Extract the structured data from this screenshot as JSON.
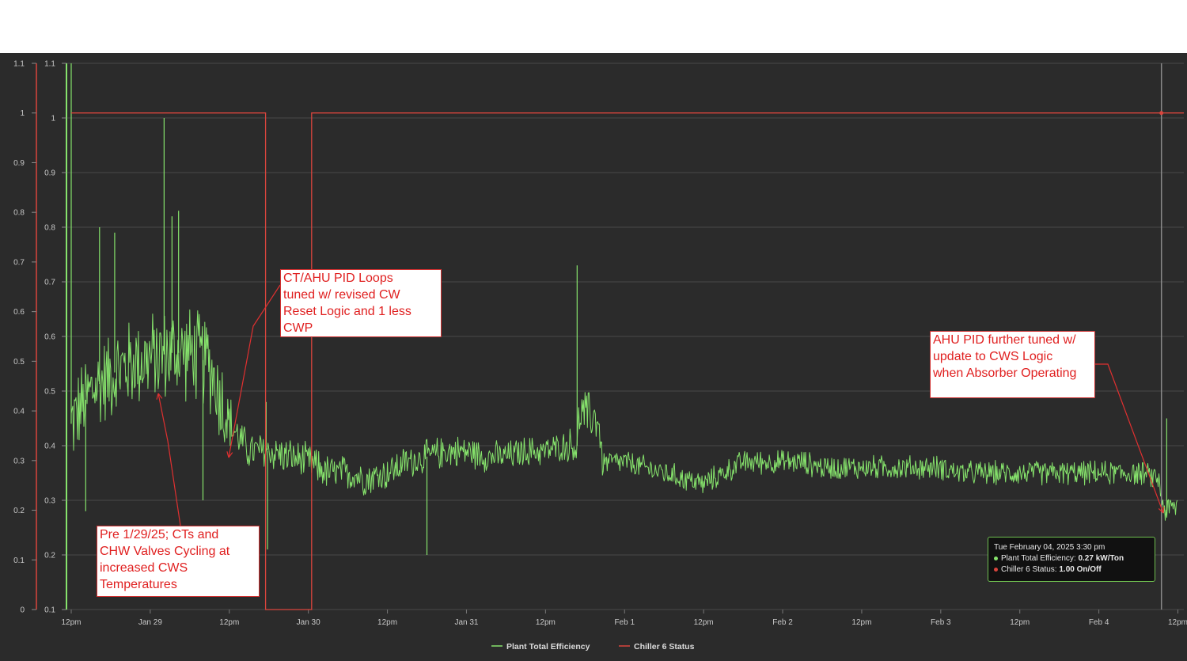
{
  "colors": {
    "background": "#2b2b2b",
    "efficiency": "#86e36c",
    "status": "#d9453d",
    "grid": "#4a4a4a",
    "axis_text": "#c8c8c8"
  },
  "chart_data": {
    "type": "line",
    "left_axis_status": {
      "ticks": [
        "1.1",
        "1",
        "0.9",
        "0.8",
        "0.7",
        "0.6",
        "0.5",
        "0.4",
        "0.3",
        "0.2",
        "0.1",
        "0"
      ],
      "ylim": [
        0,
        1.1
      ]
    },
    "left_axis_efficiency": {
      "ticks": [
        "1.1",
        "1",
        "0.9",
        "0.8",
        "0.7",
        "0.6",
        "0.5",
        "0.4",
        "0.3",
        "0.2",
        "0.1"
      ],
      "ylim": [
        0.1,
        1.1
      ]
    },
    "x_tick_labels": [
      "12pm",
      "Jan 29",
      "12pm",
      "Jan 30",
      "12pm",
      "Jan 31",
      "12pm",
      "Feb 1",
      "12pm",
      "Feb 2",
      "12pm",
      "Feb 3",
      "12pm",
      "Feb 4",
      "12pm"
    ],
    "x_units": "hours since Jan 28 12pm",
    "xlim": [
      -1.2,
      168.9
    ],
    "series": [
      {
        "name": "Plant Total Efficiency",
        "color": "#86e36c",
        "trend": [
          [
            0,
            0.44
          ],
          [
            3,
            0.5
          ],
          [
            6,
            0.53
          ],
          [
            9,
            0.55
          ],
          [
            12,
            0.56
          ],
          [
            15,
            0.57
          ],
          [
            18,
            0.57
          ],
          [
            21,
            0.55
          ],
          [
            24,
            0.44
          ],
          [
            27,
            0.39
          ],
          [
            30,
            0.39
          ],
          [
            33,
            0.38
          ],
          [
            36,
            0.37
          ],
          [
            39,
            0.35
          ],
          [
            42,
            0.35
          ],
          [
            45,
            0.34
          ],
          [
            48,
            0.35
          ],
          [
            51,
            0.37
          ],
          [
            54,
            0.38
          ],
          [
            57,
            0.39
          ],
          [
            60,
            0.39
          ],
          [
            63,
            0.38
          ],
          [
            66,
            0.38
          ],
          [
            69,
            0.39
          ],
          [
            72,
            0.39
          ],
          [
            75,
            0.4
          ],
          [
            76.8,
            0.4
          ],
          [
            77.2,
            0.46
          ],
          [
            80,
            0.45
          ],
          [
            80.6,
            0.37
          ],
          [
            84,
            0.37
          ],
          [
            87,
            0.36
          ],
          [
            90,
            0.35
          ],
          [
            93,
            0.34
          ],
          [
            96,
            0.33
          ],
          [
            99,
            0.35
          ],
          [
            102,
            0.37
          ],
          [
            105,
            0.37
          ],
          [
            108,
            0.37
          ],
          [
            111,
            0.37
          ],
          [
            114,
            0.36
          ],
          [
            117,
            0.36
          ],
          [
            120,
            0.36
          ],
          [
            123,
            0.36
          ],
          [
            126,
            0.36
          ],
          [
            129,
            0.36
          ],
          [
            132,
            0.36
          ],
          [
            135,
            0.35
          ],
          [
            138,
            0.35
          ],
          [
            141,
            0.35
          ],
          [
            144,
            0.35
          ],
          [
            147,
            0.35
          ],
          [
            150,
            0.35
          ],
          [
            153,
            0.35
          ],
          [
            156,
            0.35
          ],
          [
            159,
            0.35
          ],
          [
            162,
            0.35
          ],
          [
            165,
            0.34
          ],
          [
            166,
            0.28
          ],
          [
            168,
            0.29
          ]
        ],
        "noise_amplitude": [
          [
            0,
            0.09
          ],
          [
            23,
            0.1
          ],
          [
            25,
            0.04
          ],
          [
            75,
            0.03
          ],
          [
            77,
            0.05
          ],
          [
            80,
            0.05
          ],
          [
            81,
            0.025
          ],
          [
            165,
            0.025
          ],
          [
            168,
            0.03
          ]
        ],
        "spikes": [
          [
            0,
            1.1
          ],
          [
            14.1,
            1.0
          ],
          [
            4.3,
            0.8
          ],
          [
            6.6,
            0.79
          ],
          [
            15.3,
            0.82
          ],
          [
            16.3,
            0.83
          ],
          [
            2.2,
            0.28
          ],
          [
            20,
            0.3
          ],
          [
            29.8,
            0.21
          ],
          [
            29.6,
            0.48
          ],
          [
            54,
            0.2
          ],
          [
            76.8,
            0.73
          ],
          [
            166.3,
            0.45
          ]
        ]
      },
      {
        "name": "Chiller 6 Status",
        "color": "#d9453d",
        "points": [
          [
            0,
            1
          ],
          [
            29.5,
            1
          ],
          [
            29.5,
            0
          ],
          [
            36.5,
            0
          ],
          [
            36.5,
            1
          ],
          [
            168.9,
            1
          ]
        ]
      }
    ],
    "legend_position": "bottom-center",
    "grid": true
  },
  "annotations": {
    "pre": "Pre 1/29/25; CTs and\nCHW Valves Cycling at\nincreased CWS\nTemperatures",
    "ct_ahu": "CT/AHU PID Loops\ntuned w/ revised CW\nReset Logic and 1 less\nCWP",
    "ahu_further": "AHU PID further tuned w/\nupdate to CWS Logic\nwhen Absorber Operating"
  },
  "tooltip": {
    "date": "Tue February 04, 2025 3:30 pm",
    "efficiency_label": "Plant Total Efficiency:",
    "efficiency_value": "0.27 kW/Ton",
    "status_label": "Chiller 6 Status:",
    "status_value": "1.00 On/Off"
  }
}
